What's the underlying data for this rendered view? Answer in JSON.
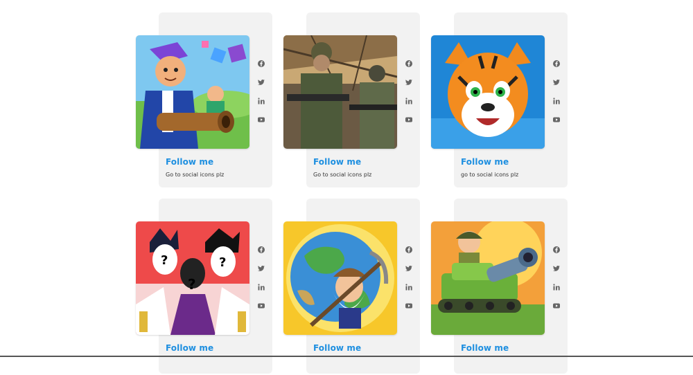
{
  "cards": [
    {
      "follow": "Follow me",
      "desc": "Go to social icons plz",
      "image": "game-hero-bazooka-image"
    },
    {
      "follow": "Follow me",
      "desc": "Go to social icons plz",
      "image": "soldiers-image"
    },
    {
      "follow": "Follow me",
      "desc": "go to social icons plz",
      "image": "tiger-image"
    },
    {
      "follow": "Follow me",
      "desc": "",
      "image": "anime-silhouettes-image"
    },
    {
      "follow": "Follow me",
      "desc": "",
      "image": "miner-globe-image"
    },
    {
      "follow": "Follow me",
      "desc": "",
      "image": "tank-soldier-image"
    }
  ],
  "social_icons": [
    "facebook-icon",
    "twitter-icon",
    "linkedin-icon",
    "youtube-icon"
  ],
  "colors": {
    "accent": "#1e8fe0",
    "panel": "#f2f2f2",
    "icon": "#666666"
  }
}
